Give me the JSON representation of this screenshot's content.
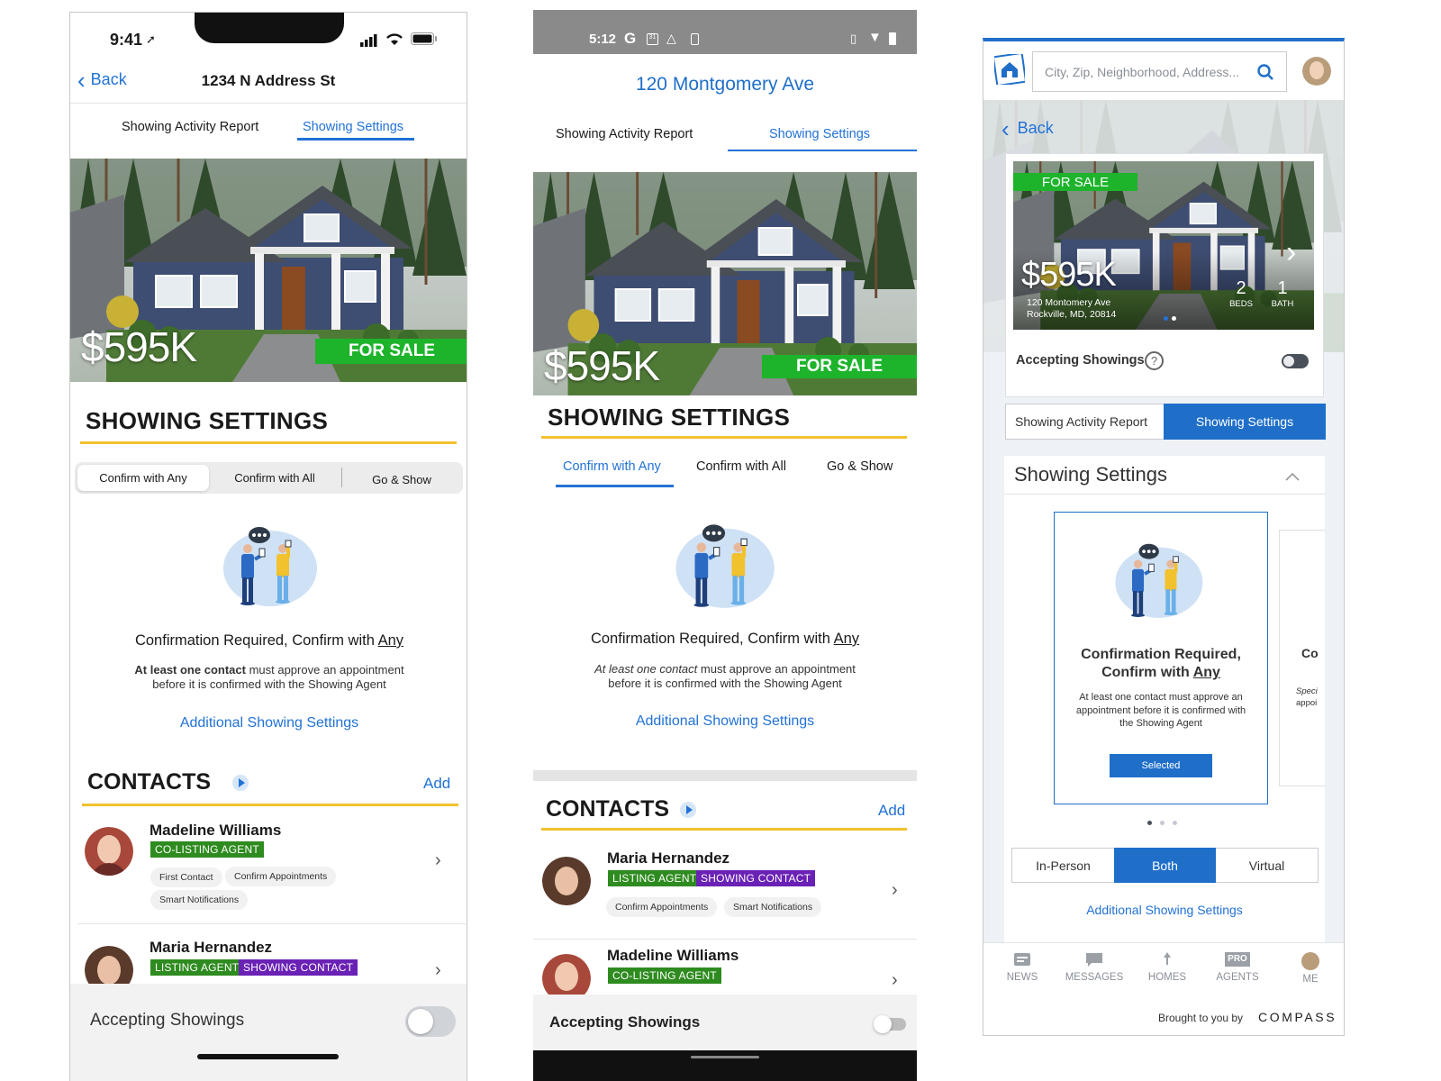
{
  "colors": {
    "blue": "#2272d6",
    "yellow": "#f2c12e",
    "green": "#1db42c",
    "purple": "#6a21b5"
  },
  "phone1": {
    "status": {
      "time": "9:41"
    },
    "nav": {
      "back": "Back",
      "title": "1234 N Address St"
    },
    "tabs": {
      "report": "Showing Activity Report",
      "settings": "Showing Settings"
    },
    "hero": {
      "price": "$595K",
      "badge": "FOR SALE"
    },
    "heading": "SHOWING SETTINGS",
    "segments": [
      "Confirm with Any",
      "Confirm with All",
      "Go & Show"
    ],
    "confirm": {
      "title_prefix": "Confirmation Required, Confirm with ",
      "title_emph": "Any",
      "body_bold": "At least one contact",
      "body_rest": " must approve an appointment",
      "body_line2": "before it is confirmed with the Showing Agent"
    },
    "additional": "Additional Showing Settings",
    "contacts_heading": "CONTACTS",
    "add": "Add",
    "contacts": [
      {
        "name": "Madeline Williams",
        "badges": [
          "CO-LISTING AGENT"
        ],
        "chips": [
          "First Contact",
          "Confirm Appointments",
          "Smart Notifications"
        ]
      },
      {
        "name": "Maria Hernandez",
        "badges": [
          "LISTING AGENT",
          "SHOWING CONTACT"
        ]
      }
    ],
    "accepting": "Accepting Showings"
  },
  "phone2": {
    "status": {
      "time": "5:12"
    },
    "title": "120 Montgomery Ave",
    "tabs": {
      "report": "Showing Activity Report",
      "settings": "Showing Settings"
    },
    "hero": {
      "price": "$595K",
      "badge": "FOR SALE"
    },
    "heading": "SHOWING SETTINGS",
    "segments": [
      "Confirm with Any",
      "Confirm with All",
      "Go & Show"
    ],
    "confirm": {
      "title_prefix": "Confirmation Required, Confirm with ",
      "title_emph": "Any",
      "body_italic": "At least one contact",
      "body_rest": " must approve an appointment",
      "body_line2": "before it is confirmed with the Showing Agent"
    },
    "additional": "Additional Showing Settings",
    "contacts_heading": "CONTACTS",
    "add": "Add",
    "contacts": [
      {
        "name": "Maria Hernandez",
        "badges": [
          "LISTING AGENT",
          "SHOWING CONTACT"
        ],
        "chips": [
          "Confirm Appointments",
          "Smart Notifications"
        ]
      },
      {
        "name": "Madeline Williams",
        "badges": [
          "CO-LISTING AGENT"
        ]
      }
    ],
    "accepting": "Accepting Showings"
  },
  "web": {
    "search_placeholder": "City, Zip, Neighborhood, Address...",
    "back": "Back",
    "listing": {
      "badge": "FOR SALE",
      "price": "$595K",
      "address1": "120 Montomery Ave",
      "address2": "Rockville, MD, 20814",
      "beds": "2",
      "beds_label": "BEDS",
      "baths": "1",
      "baths_label": "BATH"
    },
    "accepting": "Accepting Showings",
    "tabs": {
      "report": "Showing Activity Report",
      "settings": "Showing Settings"
    },
    "section_title": "Showing Settings",
    "option": {
      "title1": "Confirmation Required,",
      "title2_prefix": "Confirm with ",
      "title2_emph": "Any",
      "body": "At least one contact must approve an appointment before it is confirmed with the Showing Agent",
      "button": "Selected"
    },
    "peek": {
      "title": "Co",
      "body1": "Speci",
      "body2": "appoi"
    },
    "mode_options": [
      "In-Person",
      "Both",
      "Virtual"
    ],
    "mode_selected": "Both",
    "additional": "Additional Showing Settings",
    "bottom_nav": [
      "NEWS",
      "MESSAGES",
      "HOMES",
      "AGENTS",
      "ME"
    ],
    "agents_badge": "PRO",
    "brought_by": "Brought to you by",
    "brand": "COMPASS"
  }
}
